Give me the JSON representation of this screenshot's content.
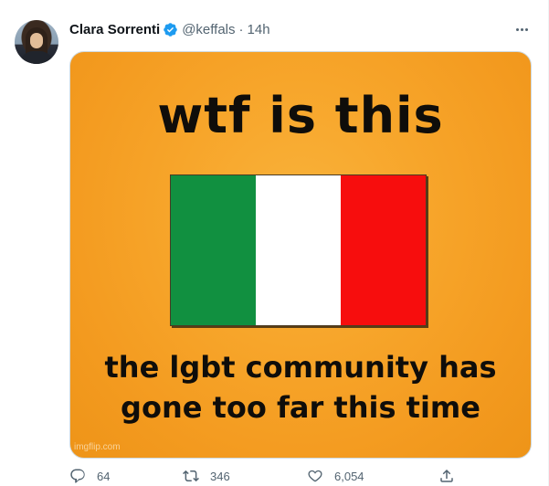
{
  "tweet": {
    "author": {
      "display_name": "Clara Sorrenti",
      "handle": "@keffals",
      "verified": true
    },
    "separator": "·",
    "time": "14h",
    "media": {
      "top_text": "wtf is this",
      "bottom_text_line1": "the lgbt community has",
      "bottom_text_line2": "gone too far this time",
      "watermark": "imgflip.com",
      "flag_colors": [
        "#119040",
        "#ffffff",
        "#f70d0d"
      ]
    },
    "actions": {
      "replies": "64",
      "retweets": "346",
      "likes": "6,054"
    }
  },
  "icons": {
    "verified": "verified-badge-icon",
    "more": "more-options-icon",
    "reply": "reply-icon",
    "retweet": "retweet-icon",
    "like": "heart-icon",
    "share": "share-icon"
  },
  "colors": {
    "accent": "#1d9bf0",
    "secondary_text": "#536471",
    "meme_background": "#f7a52a"
  }
}
